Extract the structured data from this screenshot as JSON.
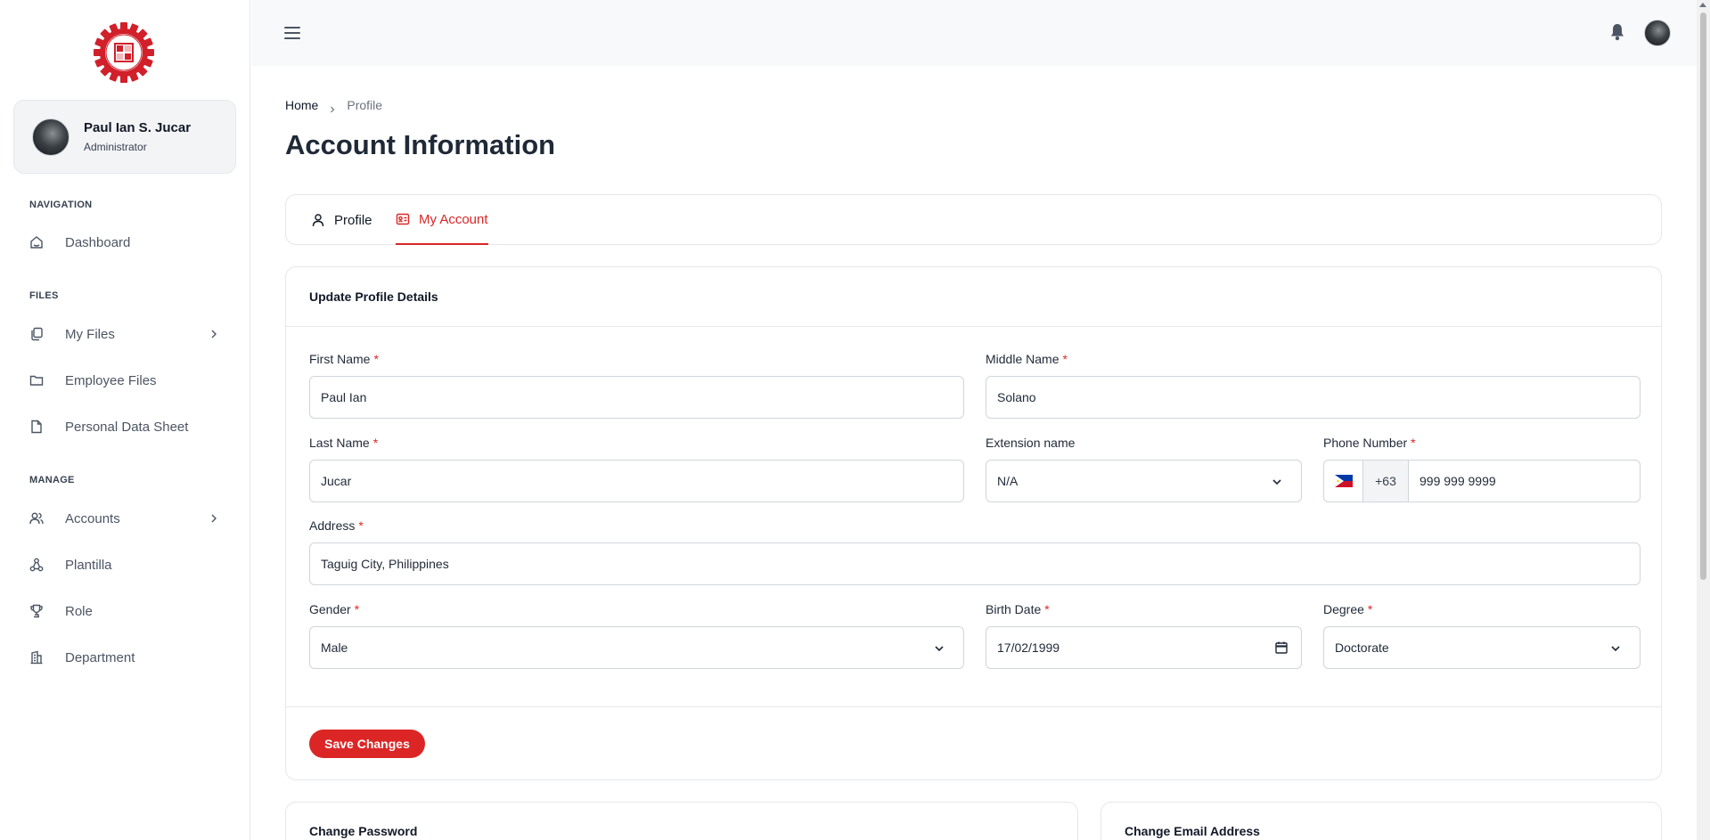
{
  "sidebar": {
    "user": {
      "name": "Paul Ian S. Jucar",
      "role": "Administrator"
    },
    "sections": {
      "navigation": "NAVIGATION",
      "files": "FILES",
      "manage": "MANAGE"
    },
    "items": [
      {
        "label": "Dashboard",
        "icon": "home-icon"
      },
      {
        "label": "My Files",
        "icon": "files-icon",
        "has_children": true
      },
      {
        "label": "Employee Files",
        "icon": "folder-icon"
      },
      {
        "label": "Personal Data Sheet",
        "icon": "document-icon"
      },
      {
        "label": "Accounts",
        "icon": "users-icon",
        "has_children": true
      },
      {
        "label": "Plantilla",
        "icon": "hierarchy-icon"
      },
      {
        "label": "Role",
        "icon": "trophy-icon"
      },
      {
        "label": "Department",
        "icon": "building-icon"
      }
    ]
  },
  "breadcrumb": {
    "home": "Home",
    "current": "Profile"
  },
  "page_title": "Account Information",
  "tabs": [
    {
      "label": "Profile",
      "active": false
    },
    {
      "label": "My Account",
      "active": true
    }
  ],
  "form": {
    "title": "Update Profile Details",
    "required_mark": "*",
    "fields": {
      "first_name": {
        "label": "First Name",
        "value": "Paul Ian"
      },
      "middle_name": {
        "label": "Middle Name",
        "value": "Solano"
      },
      "last_name": {
        "label": "Last Name",
        "value": "Jucar"
      },
      "extension_name": {
        "label": "Extension name",
        "value": "N/A"
      },
      "phone_number": {
        "label": "Phone Number",
        "code": "+63",
        "value": "999 999 9999"
      },
      "address": {
        "label": "Address",
        "value": "Taguig City, Philippines"
      },
      "gender": {
        "label": "Gender",
        "value": "Male"
      },
      "birth_date": {
        "label": "Birth Date",
        "value": "17/02/1999"
      },
      "degree": {
        "label": "Degree",
        "value": "Doctorate"
      }
    },
    "save_label": "Save Changes"
  },
  "bottom_cards": {
    "change_password": "Change Password",
    "change_email": "Change Email Address"
  },
  "colors": {
    "accent": "#dc2626",
    "sidebar_bg": "#ffffff",
    "topbar_bg": "#f8f9fa"
  }
}
